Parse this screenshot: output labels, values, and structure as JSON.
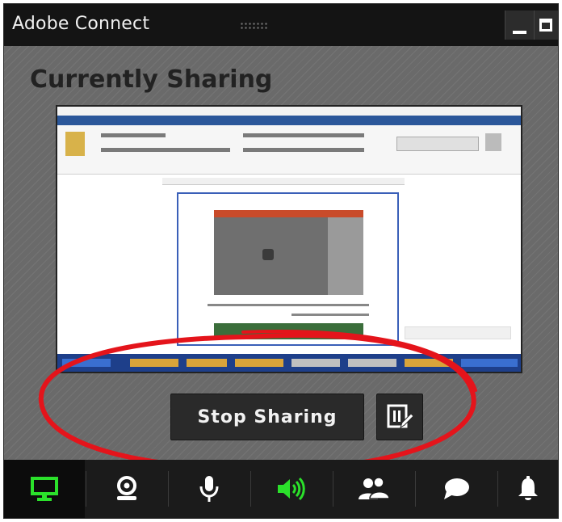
{
  "window": {
    "title": "Adobe Connect"
  },
  "content": {
    "heading": "Currently Sharing"
  },
  "actions": {
    "stop_sharing_label": "Stop Sharing"
  },
  "toolbar": {
    "items": [
      {
        "name": "share-screen",
        "icon": "monitor-icon",
        "active": true
      },
      {
        "name": "webcam",
        "icon": "webcam-icon",
        "active": false
      },
      {
        "name": "microphone",
        "icon": "microphone-icon",
        "active": false
      },
      {
        "name": "speaker",
        "icon": "speaker-icon",
        "active": true
      },
      {
        "name": "attendees",
        "icon": "attendees-icon",
        "active": false
      },
      {
        "name": "chat",
        "icon": "chat-bubble-icon",
        "active": false
      },
      {
        "name": "notifications",
        "icon": "bell-icon",
        "active": false
      }
    ]
  },
  "colors": {
    "active_green": "#2be12b",
    "annotation_red": "#e4141b",
    "toolbar_bg": "#1b1b1b",
    "titlebar_bg": "#141414"
  }
}
